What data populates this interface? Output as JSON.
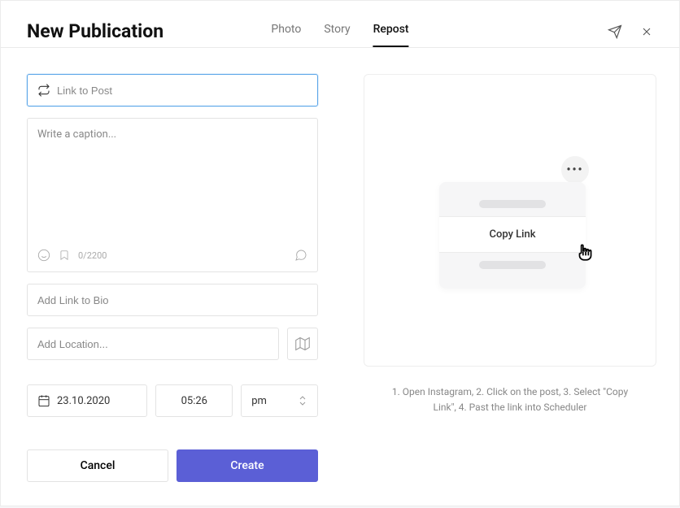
{
  "header": {
    "title": "New Publication",
    "tabs": {
      "photo": "Photo",
      "story": "Story",
      "repost": "Repost"
    }
  },
  "fields": {
    "link_placeholder": "Link to Post",
    "caption_placeholder": "Write a caption...",
    "caption_counter": "0/2200",
    "bio_placeholder": "Add Link to Bio",
    "location_placeholder": "Add Location...",
    "date_value": "23.10.2020",
    "time_value": "05:26",
    "ampm_value": "pm"
  },
  "actions": {
    "cancel": "Cancel",
    "create": "Create"
  },
  "preview": {
    "copy_link_label": "Copy Link",
    "instructions": "1. Open Instagram, 2. Click on the post, 3. Select \"Copy Link\", 4. Past the link into Scheduler"
  }
}
